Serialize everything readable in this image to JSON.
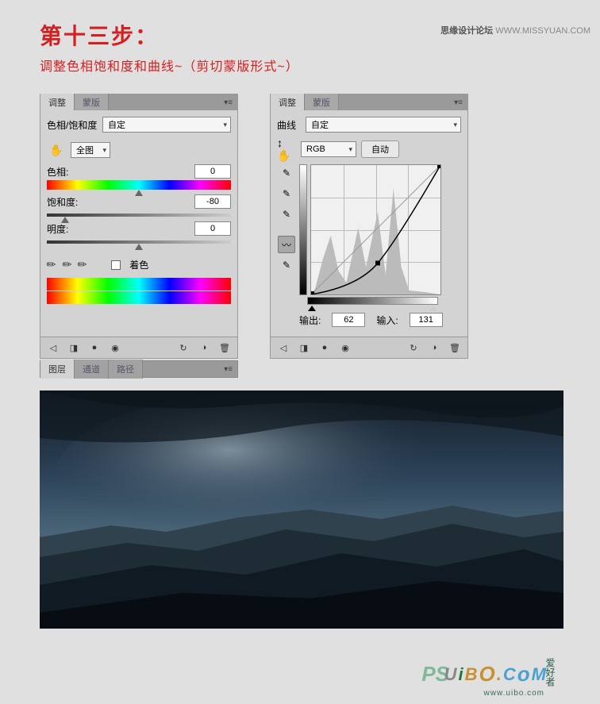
{
  "watermark": {
    "forum": "思缘设计论坛",
    "url": "WWW.MISSYUAN.COM",
    "bottom_ps": "PS",
    "bottom_brand": "UiBO.CoM",
    "bottom_small": "www.uibo.com",
    "bottom_cn": "爱好者"
  },
  "step": {
    "title": "第十三步：",
    "subtitle": "调整色相饱和度和曲线~（剪切蒙版形式~）"
  },
  "hsl_panel": {
    "tabs": {
      "active": "调整",
      "inactive": "蒙版"
    },
    "type_label": "色相/饱和度",
    "preset": "自定",
    "target": "全图",
    "hue_label": "色相:",
    "hue_value": "0",
    "saturation_label": "饱和度:",
    "saturation_value": "-80",
    "lightness_label": "明度:",
    "lightness_value": "0",
    "colorize_label": "着色"
  },
  "curves_panel": {
    "tabs": {
      "active": "调整",
      "inactive": "蒙版"
    },
    "type_label": "曲线",
    "preset": "自定",
    "channel": "RGB",
    "auto_label": "自动",
    "output_label": "输出:",
    "output_value": "62",
    "input_label": "输入:",
    "input_value": "131"
  },
  "layers_tabs": {
    "t1": "图层",
    "t2": "通道",
    "t3": "路径"
  },
  "chart_data": {
    "type": "line",
    "title": "Curves (RGB)",
    "xlabel": "Input",
    "ylabel": "Output",
    "xlim": [
      0,
      255
    ],
    "ylim": [
      0,
      255
    ],
    "control_points": [
      {
        "input": 0,
        "output": 0
      },
      {
        "input": 131,
        "output": 62
      },
      {
        "input": 255,
        "output": 255
      }
    ],
    "selected_point": {
      "input": 131,
      "output": 62
    }
  }
}
